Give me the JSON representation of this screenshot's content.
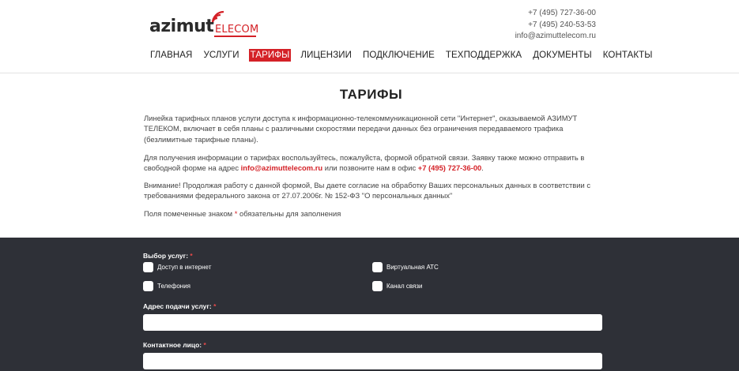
{
  "header": {
    "logo_text_main": "azimut",
    "logo_text_accent": "ELECOM",
    "contacts": {
      "phone1": "+7 (495) 727-36-00",
      "phone2": "+7 (495) 240-53-53",
      "email": "info@azimuttelecom.ru"
    },
    "nav": [
      {
        "label": "ГЛАВНАЯ",
        "active": false
      },
      {
        "label": "УСЛУГИ",
        "active": false
      },
      {
        "label": "ТАРИФЫ",
        "active": true
      },
      {
        "label": "ЛИЦЕНЗИИ",
        "active": false
      },
      {
        "label": "ПОДКЛЮЧЕНИЕ",
        "active": false
      },
      {
        "label": "ТЕХПОДДЕРЖКА",
        "active": false
      },
      {
        "label": "ДОКУМЕНТЫ",
        "active": false
      },
      {
        "label": "КОНТАКТЫ",
        "active": false
      }
    ]
  },
  "main": {
    "title": "ТАРИФЫ",
    "intro": "Линейка тарифных планов услуги доступа к информационно-телекоммуникационной сети \"Интернет\", оказываемой АЗИМУТ ТЕЛЕКОМ, включает в себя планы с различными скоростями передачи данных без ограничения передаваемого трафика (безлимитные тарифные планы).",
    "info_before": "Для получения информации о тарифах воспользуйтесь, пожалуйста, формой обратной связи. Заявку также можно отправить в свободной форме на адрес ",
    "info_email": "info@azimuttelecom.ru",
    "info_middle": " или позвоните нам в офис ",
    "info_phone": "+7 (495) 727-36-00",
    "info_end": ".",
    "warning": "Внимание! Продолжая работу с данной формой, Вы даете согласие на обработку Ваших персональных данных в соответствии с требованиями федерального закона от 27.07.2006г. № 152-ФЗ \"О персональных данных\"",
    "required_before": "Поля помеченные знаком ",
    "required_star": "*",
    "required_after": " обязательны для заполнения"
  },
  "form": {
    "services_label": "Выбор услуг:",
    "services": [
      "Доступ в интернет",
      "Виртуальная АТС",
      "Телефония",
      "Канал связи"
    ],
    "address_label": "Адрес подачи услуг:",
    "address_value": "",
    "contact_label": "Контактное лицо:",
    "contact_value": "",
    "required_mark": "*"
  },
  "colors": {
    "accent": "#d42127",
    "form_background": "#2e3037"
  }
}
